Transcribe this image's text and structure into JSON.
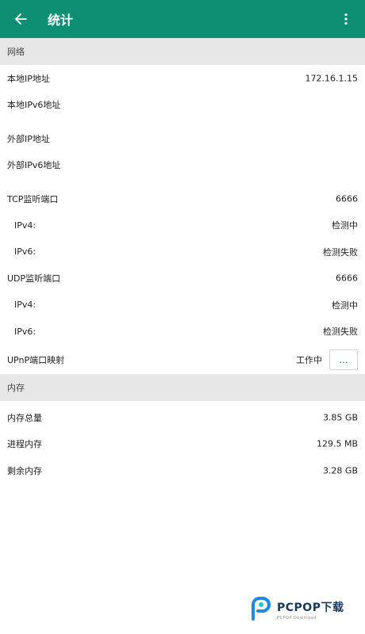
{
  "appbar": {
    "title": "统计",
    "color": "#0d8f74"
  },
  "network": {
    "header": "网络",
    "local_ip_label": "本地IP地址",
    "local_ip_value": "172.16.1.15",
    "local_ipv6_label": "本地IPv6地址",
    "external_ip_label": "外部IP地址",
    "external_ipv6_label": "外部IPv6地址",
    "tcp_label": "TCP监听端口",
    "tcp_port": "6666",
    "tcp_ipv4_label": "IPv4:",
    "tcp_ipv4_status": "检测中",
    "tcp_ipv6_label": "IPv6:",
    "tcp_ipv6_status": "检测失败",
    "udp_label": "UDP监听端口",
    "udp_port": "6666",
    "udp_ipv4_label": "IPv4:",
    "udp_ipv4_status": "检测中",
    "udp_ipv6_label": "IPv6:",
    "udp_ipv6_status": "检测失败",
    "upnp_label": "UPnP端口映射",
    "upnp_status": "工作中",
    "upnp_more": "..."
  },
  "memory": {
    "header": "内存",
    "total_label": "内存总量",
    "total_value": "3.85 GB",
    "process_label": "进程内存",
    "process_value": "129.5 MB",
    "remaining_label": "剩余内存",
    "remaining_value": "3.28 GB"
  },
  "watermark": {
    "main": "PCPOP下载",
    "sub": "PCPOP Download"
  }
}
